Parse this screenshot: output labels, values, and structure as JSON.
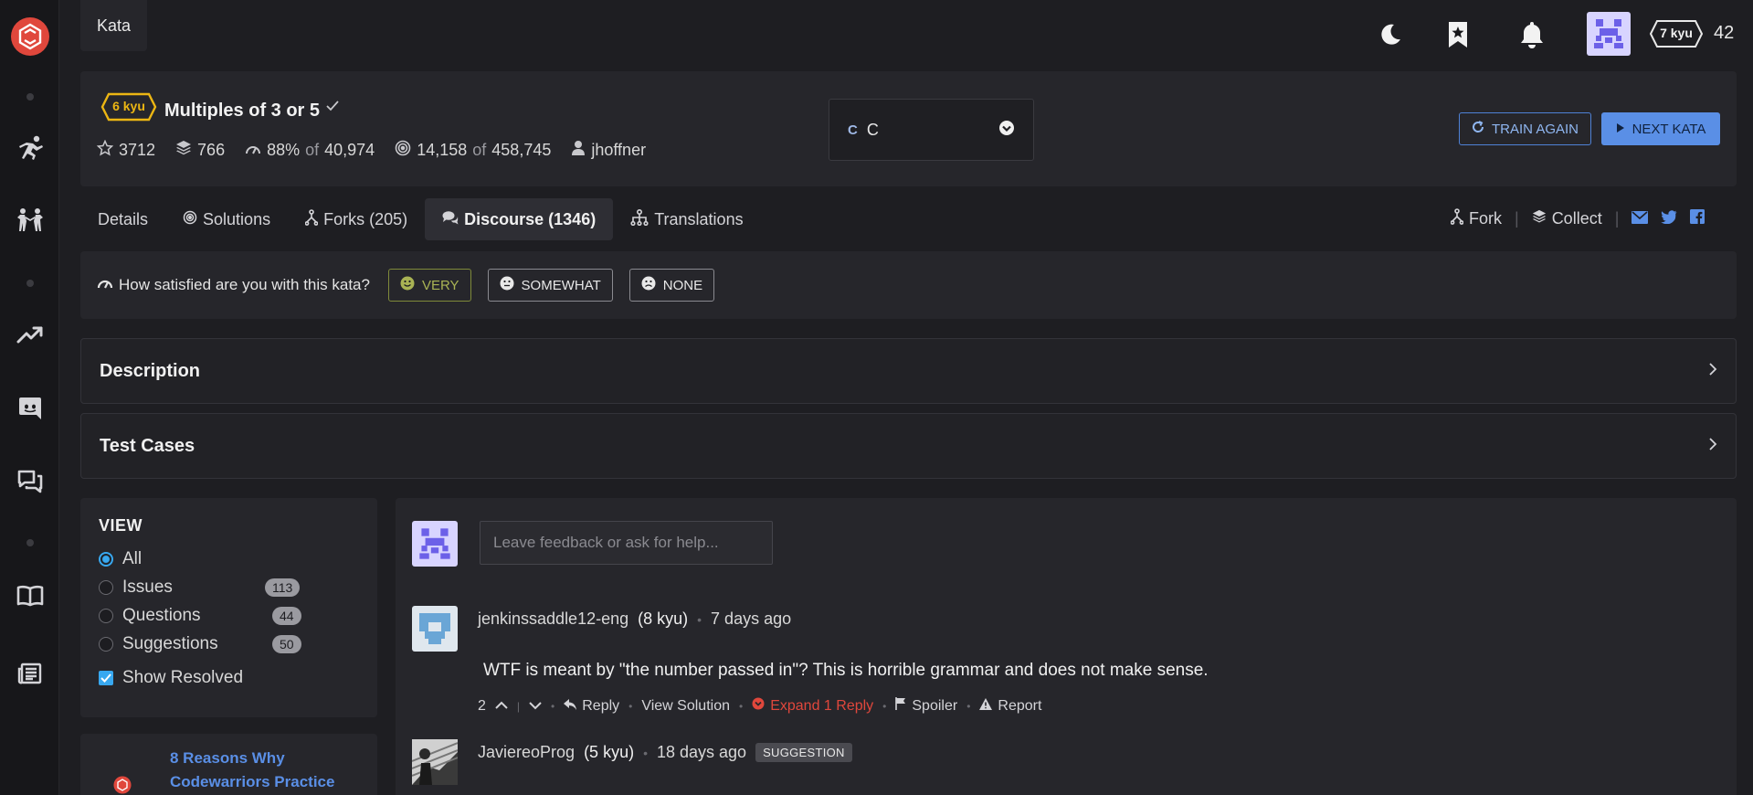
{
  "breadcrumb": {
    "label": "Kata"
  },
  "user": {
    "rank": "7 kyu",
    "honor": "42"
  },
  "kata": {
    "rank": "6 kyu",
    "title": "Multiples of 3 or 5",
    "stars": "3712",
    "collections": "766",
    "satisfaction": "88%",
    "satisfaction_of": "of",
    "satisfaction_votes": "40,974",
    "completed": "14,158",
    "completed_of": "of",
    "attempts": "458,745",
    "author": "jhoffner",
    "language": "C"
  },
  "actions": {
    "train_again": "TRAIN AGAIN",
    "next_kata": "NEXT KATA"
  },
  "tabs": [
    {
      "label": "Details"
    },
    {
      "label": "Solutions"
    },
    {
      "label": "Forks (205)"
    },
    {
      "label": "Discourse (1346)"
    },
    {
      "label": "Translations"
    }
  ],
  "tab_actions": {
    "fork": "Fork",
    "collect": "Collect"
  },
  "satisfaction": {
    "question": "How satisfied are you with this kata?",
    "very": "VERY",
    "somewhat": "SOMEWHAT",
    "none": "NONE"
  },
  "panels": {
    "description": "Description",
    "test_cases": "Test Cases"
  },
  "view": {
    "title": "VIEW",
    "all": "All",
    "issues": "Issues",
    "issues_count": "113",
    "questions": "Questions",
    "questions_count": "44",
    "suggestions": "Suggestions",
    "suggestions_count": "50",
    "show_resolved": "Show Resolved"
  },
  "promo": {
    "text": "8 Reasons Why Codewarriors Practice"
  },
  "feedback": {
    "placeholder": "Leave feedback or ask for help..."
  },
  "comments": [
    {
      "user": "jenkinssaddle12-eng",
      "rank": "(8 kyu)",
      "time": "7 days ago",
      "body": "WTF is meant by \"the number passed in\"? This is horrible grammar and does not make sense.",
      "votes": "2",
      "reply": "Reply",
      "view_solution": "View Solution",
      "expand": "Expand 1 Reply",
      "spoiler": "Spoiler",
      "report": "Report"
    },
    {
      "user": "JaviereoProg",
      "rank": "(5 kyu)",
      "time": "18 days ago",
      "tag": "SUGGESTION"
    }
  ],
  "colors": {
    "accent": "#5a8fe6",
    "kyu_yellow": "#ecb613",
    "danger": "#e0473c",
    "radio": "#38a8f0"
  }
}
